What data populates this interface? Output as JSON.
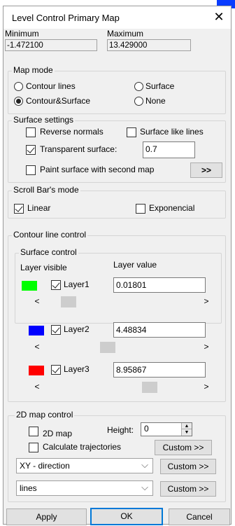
{
  "window": {
    "title": "Level Control Primary Map",
    "close_glyph": "✕"
  },
  "range": {
    "min_label": "Minimum",
    "min_value": "-1.472100",
    "max_label": "Maximum",
    "max_value": "13.429000"
  },
  "map_mode": {
    "title": "Map mode",
    "options": [
      "Contour lines",
      "Surface",
      "Contour&Surface",
      "None"
    ],
    "selected": "Contour&Surface"
  },
  "surface_settings": {
    "title": "Surface settings",
    "reverse_normals": "Reverse normals",
    "surface_like_lines": "Surface like lines",
    "transparent_surface": "Transparent surface:",
    "transparency_value": "0.7",
    "paint_second_map": "Paint surface with second map",
    "more_button": ">>"
  },
  "scroll_mode": {
    "title": "Scroll Bar's mode",
    "linear": "Linear",
    "exponencial": "Exponencial"
  },
  "contour_control": {
    "title": "Contour line control",
    "surface_control_title": "Surface control",
    "col_visible": "Layer visible",
    "col_value": "Layer value",
    "left_arrow": "<",
    "right_arrow": ">",
    "layers": [
      {
        "name": "Layer1",
        "value": "0.01801",
        "color": "#00ff00",
        "visible": true,
        "slider_fraction": 0.12
      },
      {
        "name": "Layer2",
        "value": "4.48834",
        "color": "#0000ff",
        "visible": true,
        "slider_fraction": 0.47
      },
      {
        "name": "Layer3",
        "value": "8.95867",
        "color": "#ff0000",
        "visible": true,
        "slider_fraction": 0.72
      }
    ]
  },
  "map2d": {
    "title": "2D map control",
    "map_2d": "2D map",
    "height_label": "Height:",
    "height_value": "0",
    "calc_trajectories": "Calculate trajectories",
    "custom_button": "Custom >>",
    "direction_combo": "XY - direction",
    "type_combo": "lines"
  },
  "footer": {
    "apply": "Apply",
    "ok": "OK",
    "cancel": "Cancel"
  },
  "colors": {
    "accent": "#0078d7",
    "background_peek": "#0a3cff"
  }
}
